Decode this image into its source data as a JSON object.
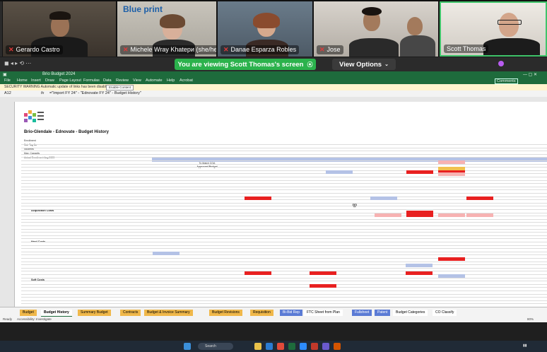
{
  "participants": [
    {
      "name": "Gerardo Castro"
    },
    {
      "name": "Michele Wray Khatери (she/her)"
    },
    {
      "name": "Danae Esparza Robles"
    },
    {
      "name": "Jose"
    },
    {
      "name": "Scott Thomas"
    }
  ],
  "blueprint_logo": "Blue print",
  "share": {
    "viewing_label": "You are viewing Scott Thomas's screen",
    "view_options_label": "View Options"
  },
  "excel": {
    "window_title": "Brio Budget 2024",
    "menu": [
      "File",
      "Home",
      "Insert",
      "Draw",
      "Page Layout",
      "Formulas",
      "Data",
      "Review",
      "View",
      "Automate",
      "Help",
      "Acrobat"
    ],
    "comments_label": "Comments",
    "security_text": "SECURITY WARNING  Automatic update of links has been disabled",
    "security_button": "Enable Content",
    "cell_ref": "A12",
    "formula": "=\"Import FY 24\" - \"Ednovate FY 24\" - Budget History\"",
    "sheet_title": "Brio-Glendale - Ednovate - Budget History",
    "meta_lines": [
      "Enrollment",
      "Sub Tag No",
      "Students",
      "Max. Capacity",
      "Actual Enrollment Aug 2023"
    ],
    "center_label": [
      "To Match COA",
      "Approved Budget"
    ],
    "sections": [
      "Acquisition Costs",
      "Hard Costs",
      "Soft Costs"
    ],
    "tabs": [
      "Budget",
      "Budget History",
      "Summary Budget",
      "Contracts",
      "Budget & Invoice Summary",
      "Budget Revisions",
      "Requisition",
      "Bi-Bid Rep",
      "FTC Sheet from Plan",
      "Fullsheet",
      "Patent",
      "Budget Categories",
      "CO Classify"
    ],
    "active_tab": "Budget History",
    "status_left": "Ready",
    "status_accessibility": "Accessibility: Investigate",
    "zoom": "80%"
  },
  "taskbar": {
    "search_placeholder": "Search"
  }
}
